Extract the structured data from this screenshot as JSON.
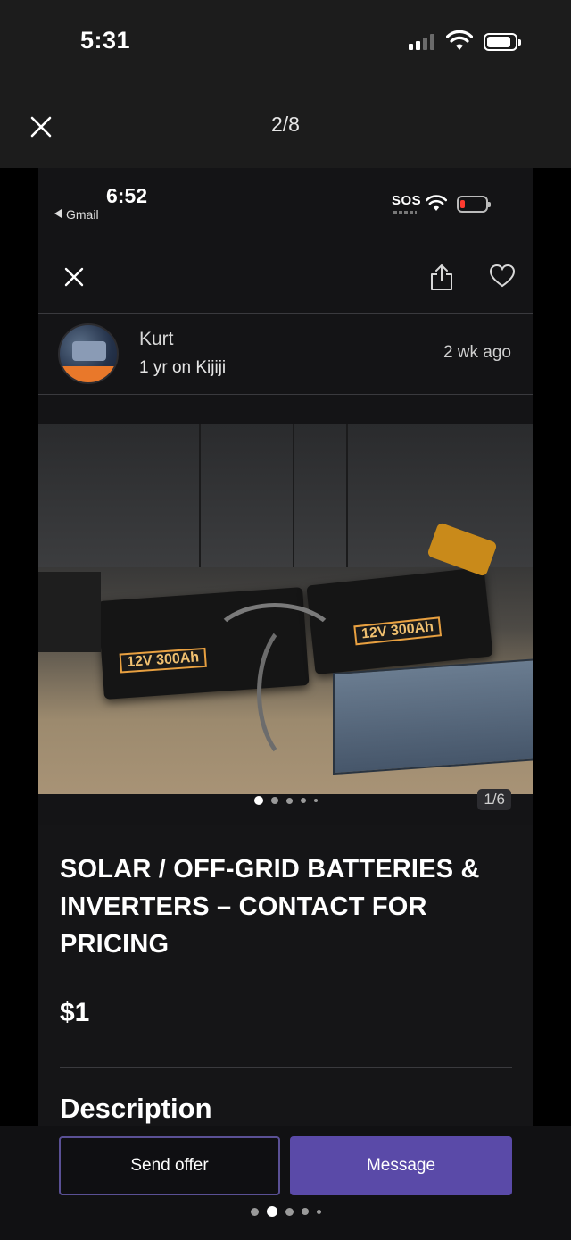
{
  "status_bar": {
    "time": "5:31"
  },
  "viewer": {
    "counter": "2/8"
  },
  "embedded_screenshot": {
    "status_bar": {
      "time": "6:52",
      "back_app": "Gmail",
      "carrier": "SOS"
    },
    "seller": {
      "name": "Kurt",
      "tenure": "1 yr on Kijiji",
      "posted": "2 wk  ago"
    },
    "photo": {
      "counter": "1/6",
      "dots_total": 5,
      "active_dot": 0
    },
    "listing": {
      "title": "SOLAR / OFF-GRID BATTERIES & INVERTERS – CONTACT FOR PRICING",
      "price": "$1",
      "description_heading": "Description"
    },
    "photo_labels": {
      "battery_left": "12V 300Ah",
      "battery_right": "12V 300Ah"
    }
  },
  "actions": {
    "send_offer": "Send offer",
    "message": "Message"
  },
  "viewer_dots": {
    "total": 5,
    "active": 1
  },
  "colors": {
    "accent": "#5a4aa8",
    "outline": "#5a5095",
    "background": "#000000"
  }
}
